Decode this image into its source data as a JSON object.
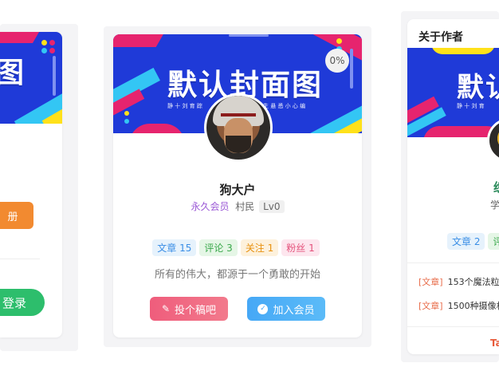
{
  "center_card": {
    "cover": {
      "title": "默认封面图",
      "subtitle_left": "静 十 刘 育 踪",
      "subtitle_right": "生 悬 悉 小 心 编"
    },
    "progress_badge": "0%",
    "username": "狗大户",
    "vip_label": "永久会员",
    "level_label": "村民",
    "level_badge": "Lv0",
    "tags": [
      {
        "label": "文章 15",
        "color": "#3a8ee6",
        "bg": "#e6f2fc"
      },
      {
        "label": "评论 3",
        "color": "#3aa84b",
        "bg": "#e5f6e6"
      },
      {
        "label": "关注 1",
        "color": "#e8910f",
        "bg": "#fdf1dc"
      },
      {
        "label": "粉丝 1",
        "color": "#e4527c",
        "bg": "#fde6ee"
      }
    ],
    "motto": "所有的伟大，都源于一个勇敢的开始",
    "submit_button": "投个稿吧",
    "join_button": "加入会员"
  },
  "left_card": {
    "cover_title_fragment": "图",
    "register_button": "册",
    "login_button": "登录"
  },
  "right_card": {
    "section_title": "关于作者",
    "cover_title_fragment": "默认",
    "subtitle_fragment": "静 十 刘 育",
    "name_fragment": "织",
    "subline_fragment": "学",
    "tag_fragments": [
      "文章 2",
      "评"
    ],
    "articles": [
      {
        "kind": "[文章]",
        "title": "153个魔法粒"
      },
      {
        "kind": "[文章]",
        "title": "1500种摄像机"
      }
    ],
    "footer_fragment": "Ta"
  },
  "colors": {
    "cover_blue": "#1f3ad8",
    "stripe_pink": "#e6246e",
    "stripe_cyan": "#33c6f4",
    "stripe_yellow": "#ffe11a",
    "orange_button": "#f28a30",
    "green_button": "#2dbe6c",
    "pink_button": "#f0607e",
    "blue_button": "#3ea6f5",
    "vip_purple": "#9b59d6"
  }
}
